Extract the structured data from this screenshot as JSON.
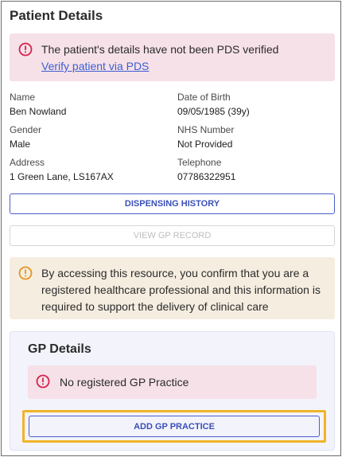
{
  "panel": {
    "title": "Patient Details"
  },
  "pds_alert": {
    "message": "The patient's details have not been PDS verified",
    "link": "Verify patient via PDS",
    "icon": "alert-circle-icon"
  },
  "details": {
    "name_label": "Name",
    "name_value": "Ben Nowland",
    "dob_label": "Date of Birth",
    "dob_value": "09/05/1985 (39y)",
    "gender_label": "Gender",
    "gender_value": "Male",
    "nhs_label": "NHS Number",
    "nhs_value": "Not Provided",
    "address_label": "Address",
    "address_value": "1 Green Lane, LS167AX",
    "phone_label": "Telephone",
    "phone_value": "07786322951"
  },
  "buttons": {
    "dispensing_history": "DISPENSING HISTORY",
    "view_gp_record": "VIEW GP RECORD"
  },
  "access_warning": {
    "message": "By accessing this resource, you confirm that you are a registered healthcare professional and this information is required to support the delivery of clinical care",
    "icon": "warning-circle-icon"
  },
  "gp": {
    "title": "GP Details",
    "alert": "No registered GP Practice",
    "add_button": "ADD GP PRACTICE"
  },
  "colors": {
    "error_bg": "#f6e1e8",
    "error_icon": "#d4244e",
    "warning_bg": "#f5ede0",
    "warning_icon": "#e6951e",
    "primary": "#3b4fb8",
    "highlight": "#f0b429"
  }
}
